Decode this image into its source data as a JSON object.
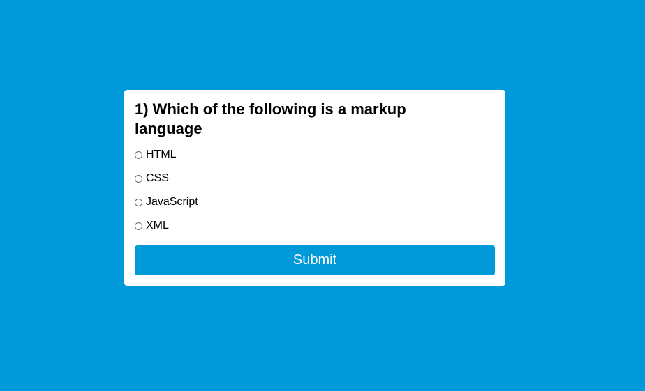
{
  "quiz": {
    "question": "1) Which of the following is a markup language",
    "options": [
      {
        "label": "HTML",
        "selected": false
      },
      {
        "label": "CSS",
        "selected": false
      },
      {
        "label": "JavaScript",
        "selected": false
      },
      {
        "label": "XML",
        "selected": false
      }
    ],
    "submit_label": "Submit"
  },
  "colors": {
    "background": "#0099d9",
    "card": "#ffffff",
    "button": "#0099d9",
    "button_text": "#ffffff"
  }
}
